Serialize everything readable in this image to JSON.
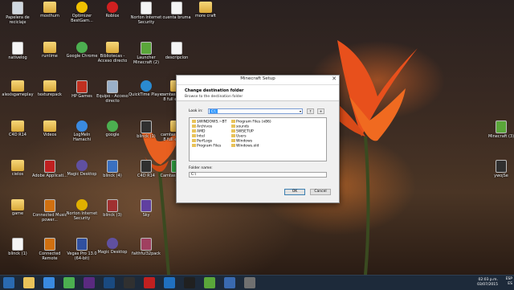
{
  "desktop": {
    "icons": [
      {
        "label": "Papelera de reciclaje",
        "kind": "doc",
        "color": "#d0d8e0"
      },
      {
        "label": "mosthum",
        "kind": "folder",
        "color": "#e8c35a"
      },
      {
        "label": "Optimizer BestGam...",
        "kind": "round",
        "color": "#f0c000"
      },
      {
        "label": "Roblox",
        "kind": "round",
        "color": "#d02020"
      },
      {
        "label": "Norton Internet Security",
        "kind": "doc",
        "color": "#f5f5f5"
      },
      {
        "label": "cuenta bruma",
        "kind": "doc",
        "color": "#f5f5f5"
      },
      {
        "label": "more craft",
        "kind": "folder",
        "color": "#e8c35a"
      },
      {
        "label": "nativelog",
        "kind": "doc",
        "color": "#f5f5f5"
      },
      {
        "label": "runtime",
        "kind": "folder",
        "color": "#e8c35a"
      },
      {
        "label": "Google Chrome",
        "kind": "round",
        "color": "#4caf50"
      },
      {
        "label": "Bibliotecas - Acceso directo",
        "kind": "folder",
        "color": "#e8c35a"
      },
      {
        "label": "Launcher Minecraft (2)",
        "kind": "doc",
        "color": "#5aa63a"
      },
      {
        "label": "descripcion",
        "kind": "doc",
        "color": "#f5f5f5"
      },
      {
        "label": "alexisgameplay",
        "kind": "folder",
        "color": "#e8c35a"
      },
      {
        "label": "texturepack",
        "kind": "folder",
        "color": "#e8c35a"
      },
      {
        "label": "HP Games",
        "kind": "doc",
        "color": "#c03020"
      },
      {
        "label": "Equipo - Acceso directo",
        "kind": "doc",
        "color": "#9ab0c8"
      },
      {
        "label": "QuickTime Player",
        "kind": "round",
        "color": "#2a8ad0"
      },
      {
        "label": "camtasia studio 8 full español",
        "kind": "folder",
        "color": "#e8c35a"
      },
      {
        "label": "C4D R14",
        "kind": "folder",
        "color": "#e8c35a"
      },
      {
        "label": "Videos",
        "kind": "folder",
        "color": "#e8c35a"
      },
      {
        "label": "LogMeIn Hamachi",
        "kind": "round",
        "color": "#3a8ae0"
      },
      {
        "label": "google",
        "kind": "round",
        "color": "#4caf50"
      },
      {
        "label": "blinck (1)",
        "kind": "doc",
        "color": "#303030"
      },
      {
        "label": "camtasia studio 8 full español",
        "kind": "folder",
        "color": "#e8c35a"
      },
      {
        "label": "cielos",
        "kind": "folder",
        "color": "#e8c35a"
      },
      {
        "label": "Adobe Applicati...",
        "kind": "doc",
        "color": "#c02020"
      },
      {
        "label": "Magic Desktop",
        "kind": "round",
        "color": "#6050a0"
      },
      {
        "label": "blinck (4)",
        "kind": "doc",
        "color": "#3a70c0"
      },
      {
        "label": "C4D R14",
        "kind": "doc",
        "color": "#303030"
      },
      {
        "label": "Camtasia Studio 8",
        "kind": "doc",
        "color": "#30a040"
      },
      {
        "label": "game",
        "kind": "folder",
        "color": "#e8c35a"
      },
      {
        "label": "Connected Music power...",
        "kind": "doc",
        "color": "#d07010"
      },
      {
        "label": "Norton Internet Security",
        "kind": "round",
        "color": "#e0b000"
      },
      {
        "label": "blinck (3)",
        "kind": "doc",
        "color": "#a03030"
      },
      {
        "label": "Sky",
        "kind": "doc",
        "color": "#6040a0"
      },
      {
        "label": "blinck (1)",
        "kind": "doc",
        "color": "#f5f5f5"
      },
      {
        "label": "Connected Remote",
        "kind": "doc",
        "color": "#d07010"
      },
      {
        "label": "Vegas Pro 13.0 (64-bit)",
        "kind": "doc",
        "color": "#3050a0"
      },
      {
        "label": "Magic Desktop",
        "kind": "round",
        "color": "#6050a0"
      },
      {
        "label": "faithful32pack",
        "kind": "doc",
        "color": "#a04060"
      },
      {
        "label": "Minecraft (3)",
        "kind": "doc",
        "color": "#5aa63a"
      },
      {
        "label": "ywojSe",
        "kind": "doc",
        "color": "#303030"
      }
    ]
  },
  "dialog": {
    "title": "Minecraft Setup",
    "close_glyph": "✕",
    "heading": "Change destination folder",
    "subheading": "Browse to the destination folder",
    "lookin_label": "Look in:",
    "lookin_value": "C:\\",
    "up_glyph": "↑",
    "newfolder_glyph": "+",
    "files_col1": [
      "$WINDOWS.~BT",
      "Archivos",
      "AMD",
      "Intel",
      "PerfLogs",
      "Program Files"
    ],
    "files_col2": [
      "Program Files (x86)",
      "sounds",
      "SWSETUP",
      "Users",
      "Windows",
      "Windows.old"
    ],
    "folder_name_label": "Folder name:",
    "folder_name_value": "C:\\",
    "ok_label": "OK",
    "cancel_label": "Cancel"
  },
  "taskbar": {
    "items": [
      {
        "name": "windows-icon",
        "color": "#2a6ab0"
      },
      {
        "name": "file-explorer-icon",
        "color": "#e8c35a"
      },
      {
        "name": "store-icon",
        "color": "#3a8ae0"
      },
      {
        "name": "chrome-icon",
        "color": "#4caf50"
      },
      {
        "name": "premiere-icon",
        "color": "#5a2a80"
      },
      {
        "name": "photoshop-icon",
        "color": "#1a4a80"
      },
      {
        "name": "c4d-icon",
        "color": "#303030"
      },
      {
        "name": "record-icon",
        "color": "#c02020"
      },
      {
        "name": "hp-icon",
        "color": "#2070c0"
      },
      {
        "name": "cinema-icon",
        "color": "#202020"
      },
      {
        "name": "minecraft-icon",
        "color": "#5aa63a"
      },
      {
        "name": "mediaplayer-icon",
        "color": "#3a6ab0"
      },
      {
        "name": "setup-icon",
        "color": "#707070"
      }
    ],
    "tray_lang": "ESP",
    "tray_locale": "ES",
    "time": "02:03 p.m.",
    "date": "03/07/2015"
  }
}
